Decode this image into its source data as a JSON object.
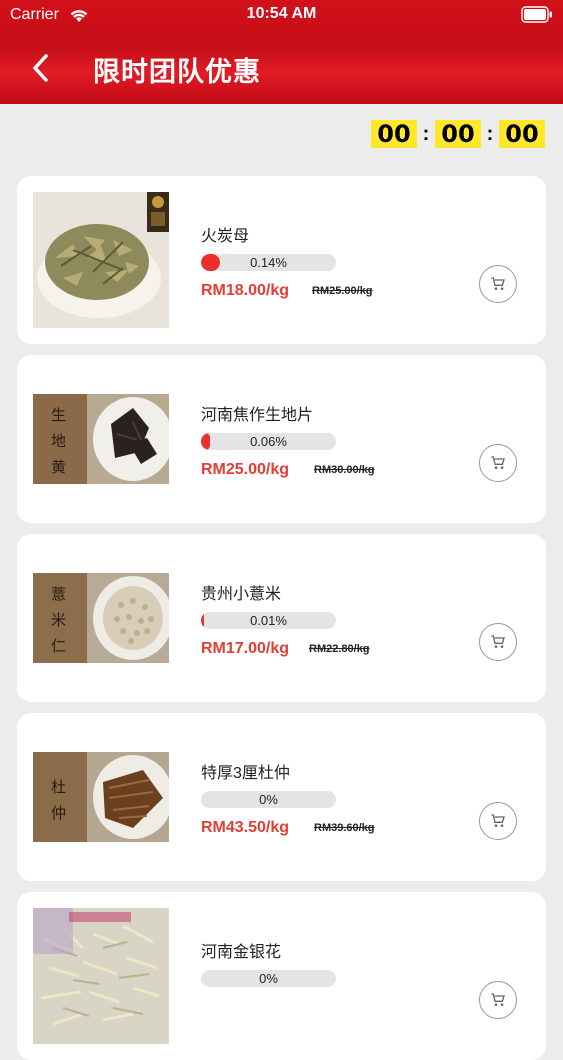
{
  "status_bar": {
    "carrier": "Carrier",
    "time": "10:54 AM"
  },
  "header": {
    "title": "限时团队优惠",
    "back_icon": "chevron-left-icon"
  },
  "countdown": {
    "hours": "00",
    "minutes": "00",
    "seconds": "00",
    "separator": ":"
  },
  "colors": {
    "brand_red": "#d3101a",
    "price_red": "#e33d36",
    "countdown_yellow": "#ffe82a",
    "progress_fill": "#ec2f27"
  },
  "products": [
    {
      "name": "火炭母",
      "progress_label": "0.14%",
      "progress": 0.0014,
      "price": "RM18.00/kg",
      "old_price": "RM25.00/kg",
      "image": "dried-herb-leaves",
      "cart_icon": "cart-icon"
    },
    {
      "name": "河南焦作生地片",
      "progress_label": "0.06%",
      "progress": 0.0006,
      "price": "RM25.00/kg",
      "old_price": "RM30.00/kg",
      "image": "dark-root-slices",
      "image_text": "生地黄",
      "cart_icon": "cart-icon"
    },
    {
      "name": "贵州小薏米",
      "progress_label": "0.01%",
      "progress": 0.0001,
      "price": "RM17.00/kg",
      "old_price": "RM22.80/kg",
      "image": "barley-grains",
      "image_text": "薏米仁",
      "cart_icon": "cart-icon"
    },
    {
      "name": "特厚3厘杜仲",
      "progress_label": "0%",
      "progress": 0,
      "price": "RM43.50/kg",
      "old_price": "RM39.60/kg",
      "image": "bark-pieces",
      "image_text": "杜仲",
      "cart_icon": "cart-icon"
    },
    {
      "name": "河南金银花",
      "progress_label": "0%",
      "progress": 0,
      "price": "",
      "old_price": "",
      "image": "dried-flowers",
      "cart_icon": "cart-icon"
    }
  ]
}
